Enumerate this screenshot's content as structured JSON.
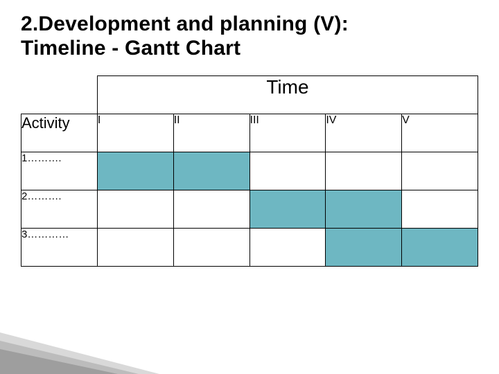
{
  "title_line1": "2.Development and planning (V):",
  "title_line2": "Timeline - Gantt Chart",
  "gantt": {
    "time_header": "Time",
    "activity_header": "Activity",
    "columns": [
      "I",
      "II",
      "III",
      "IV",
      "V"
    ],
    "rows": [
      {
        "label": "1……….",
        "filled": [
          true,
          true,
          false,
          false,
          false
        ]
      },
      {
        "label": "2……….",
        "filled": [
          false,
          false,
          true,
          true,
          false
        ]
      },
      {
        "label": "3…………",
        "filled": [
          false,
          false,
          false,
          true,
          true
        ]
      }
    ]
  },
  "colors": {
    "bar_fill": "#6eb7c2"
  },
  "chart_data": {
    "type": "bar",
    "title": "Timeline - Gantt Chart",
    "xlabel": "Time",
    "ylabel": "Activity",
    "categories": [
      "I",
      "II",
      "III",
      "IV",
      "V"
    ],
    "series": [
      {
        "name": "1……….",
        "values": [
          1,
          1,
          0,
          0,
          0
        ]
      },
      {
        "name": "2……….",
        "values": [
          0,
          0,
          1,
          1,
          0
        ]
      },
      {
        "name": "3…………",
        "values": [
          0,
          0,
          0,
          1,
          1
        ]
      }
    ],
    "ylim": [
      0,
      1
    ]
  }
}
